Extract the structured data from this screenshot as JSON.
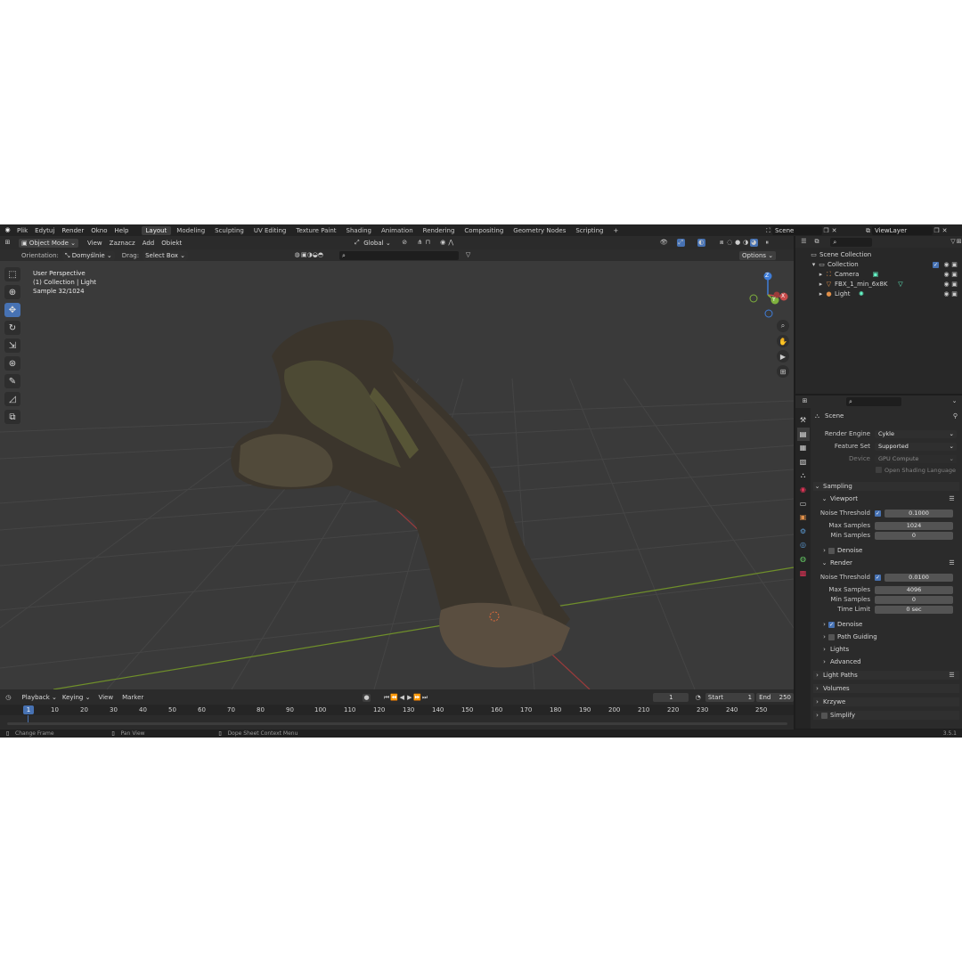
{
  "menu": {
    "items": [
      "Plik",
      "Edytuj",
      "Render",
      "Okno",
      "Help"
    ]
  },
  "workspaces": [
    "Layout",
    "Modeling",
    "Sculpting",
    "UV Editing",
    "Texture Paint",
    "Shading",
    "Animation",
    "Rendering",
    "Compositing",
    "Geometry Nodes",
    "Scripting"
  ],
  "top_right": {
    "scene": "Scene",
    "view_layer": "ViewLayer"
  },
  "viewport_header": {
    "mode": "Object Mode",
    "menus": [
      "View",
      "Zaznacz",
      "Add",
      "Obiekt"
    ],
    "transform": "Global",
    "orientation_label": "Orientation:",
    "orientation_value": "Domyślnie",
    "drag_label": "Drag:",
    "drag_value": "Select Box",
    "options": "Options"
  },
  "viewport_overlay": {
    "line1": "User Perspective",
    "line2": "(1) Collection | Light",
    "line3": "Sample 32/1024"
  },
  "gizmo": {
    "x": "X",
    "y": "Y",
    "z": "Z"
  },
  "timeline": {
    "menus": [
      "Playback",
      "Keying",
      "View",
      "Marker"
    ],
    "current_frame": "1",
    "start_label": "Start",
    "start": "1",
    "end_label": "End",
    "end": "250",
    "ruler": [
      "1",
      "10",
      "20",
      "30",
      "40",
      "50",
      "60",
      "70",
      "80",
      "90",
      "100",
      "110",
      "120",
      "130",
      "140",
      "150",
      "160",
      "170",
      "180",
      "190",
      "200",
      "210",
      "220",
      "230",
      "240",
      "250"
    ]
  },
  "status_bar": {
    "change_frame": "Change Frame",
    "pan_view": "Pan View",
    "context_menu": "Dope Sheet Context Menu",
    "version": "3.5.1"
  },
  "outliner": {
    "root": "Scene Collection",
    "collection": "Collection",
    "items": [
      "Camera",
      "FBX_1_min_6x8K",
      "Light"
    ]
  },
  "properties": {
    "context": "Scene",
    "render_engine_label": "Render Engine",
    "render_engine": "Cykle",
    "feature_set_label": "Feature Set",
    "feature_set": "Supported",
    "device_label": "Device",
    "device": "GPU Compute",
    "osl": "Open Shading Language",
    "sampling": "Sampling",
    "viewport": {
      "title": "Viewport",
      "noise_threshold_label": "Noise Threshold",
      "noise_threshold": "0.1000",
      "max_samples_label": "Max Samples",
      "max_samples": "1024",
      "min_samples_label": "Min Samples",
      "min_samples": "0",
      "denoise": "Denoise"
    },
    "render": {
      "title": "Render",
      "noise_threshold_label": "Noise Threshold",
      "noise_threshold": "0.0100",
      "max_samples_label": "Max Samples",
      "max_samples": "4096",
      "min_samples_label": "Min Samples",
      "min_samples": "0",
      "time_limit_label": "Time Limit",
      "time_limit": "0 sec",
      "denoise": "Denoise",
      "path_guiding": "Path Guiding",
      "lights": "Lights",
      "advanced": "Advanced"
    },
    "sections": [
      "Light Paths",
      "Volumes",
      "Krzywe",
      "Simplify"
    ]
  },
  "colors": {
    "accent": "#4772b3",
    "grid_x": "#9b3b3b",
    "grid_y": "#6f8f2a",
    "viewport_bg": "#3a3a3a"
  }
}
